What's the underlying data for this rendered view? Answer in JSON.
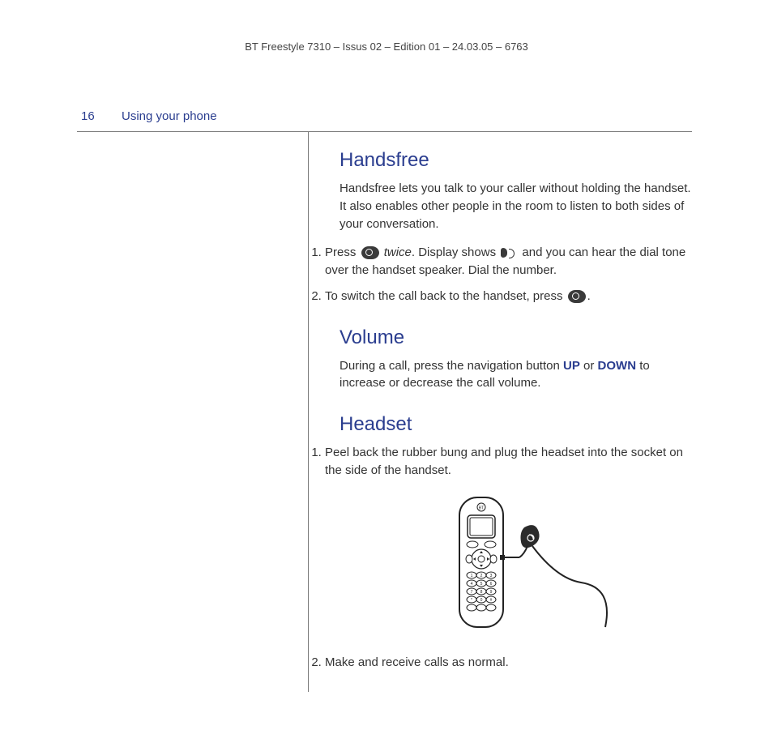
{
  "docHeader": "BT Freestyle 7310 – Issus 02 – Edition 01 – 24.03.05 – 6763",
  "pageNumber": "16",
  "sectionTitle": "Using your phone",
  "handsfree": {
    "heading": "Handsfree",
    "intro": "Handsfree lets you talk to your caller without holding the handset. It also enables other people in the room to listen to both sides of your conversation.",
    "step1_a": "Press ",
    "step1_twice": "twice",
    "step1_b": ". Display shows ",
    "step1_c": " and you can hear the dial tone over the handset speaker. Dial the number.",
    "step2_a": "To switch the call back to the handset, press ",
    "step2_b": "."
  },
  "volume": {
    "heading": "Volume",
    "body_a": "During a call, press the navigation button ",
    "up": "UP",
    "or": " or ",
    "down": "DOWN",
    "body_b": " to increase or decrease the call volume."
  },
  "headset": {
    "heading": "Headset",
    "step1": "Peel back the rubber bung and plug the headset into the socket on the side of the handset.",
    "step2": "Make and receive calls as normal."
  }
}
